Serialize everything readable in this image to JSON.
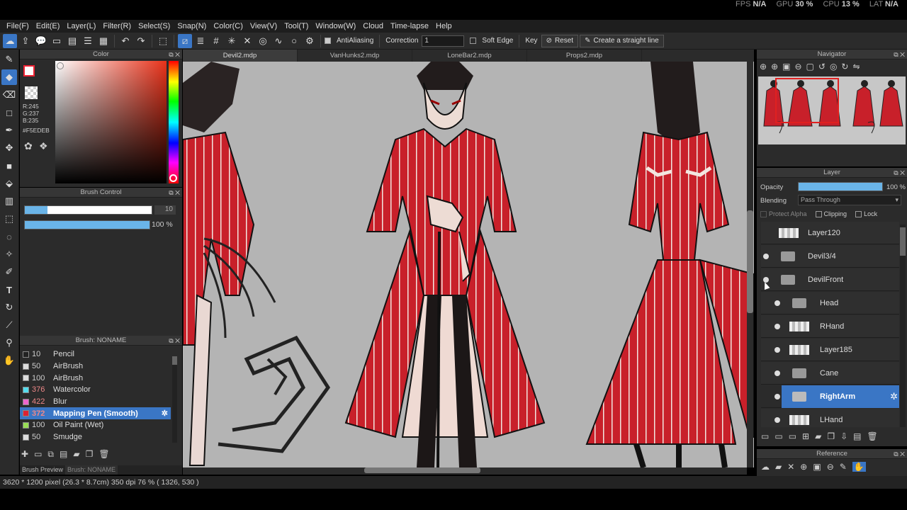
{
  "stats": {
    "fps_label": "FPS",
    "fps": "N/A",
    "gpu_label": "GPU",
    "gpu": "30 %",
    "cpu_label": "CPU",
    "cpu": "13 %",
    "lat_label": "LAT",
    "lat": "N/A"
  },
  "menu": [
    "File(F)",
    "Edit(E)",
    "Layer(L)",
    "Filter(R)",
    "Select(S)",
    "Snap(N)",
    "Color(C)",
    "View(V)",
    "Tool(T)",
    "Window(W)",
    "Cloud",
    "Time-lapse",
    "Help"
  ],
  "toolbar": {
    "antialiasing_label": "AntiAliasing",
    "correction_label": "Correction",
    "correction_value": "1",
    "soft_edge_label": "Soft Edge",
    "key_label": "Key",
    "reset_label": "Reset",
    "straight_line_label": "Create a straight line"
  },
  "color": {
    "panel_title": "Color",
    "r": "R:245",
    "g": "G:237",
    "b": "B:235",
    "hex": "#F5EDEB",
    "accent": "#3a76c5"
  },
  "brush_control": {
    "panel_title": "Brush Control",
    "size_value": "10",
    "opacity_value": "100 %"
  },
  "brush_panel": {
    "panel_title": "Brush: NONAME",
    "footer_tab1": "Brush Preview",
    "footer_tab2": "Brush: NONAME",
    "items": [
      {
        "size": "10",
        "name": "Pencil",
        "swatch": "#222222"
      },
      {
        "size": "50",
        "name": "AirBrush",
        "swatch": "#dddddd"
      },
      {
        "size": "100",
        "name": "AirBrush",
        "swatch": "#dddddd"
      },
      {
        "size": "376",
        "name": "Watercolor",
        "swatch": "#55ddee"
      },
      {
        "size": "422",
        "name": "Blur",
        "swatch": "#ee66cc"
      },
      {
        "size": "372",
        "name": "Mapping Pen (Smooth)",
        "swatch": "#dd2233"
      },
      {
        "size": "100",
        "name": "Oil Paint (Wet)",
        "swatch": "#99dd55"
      },
      {
        "size": "50",
        "name": "Smudge",
        "swatch": "#dddddd"
      }
    ]
  },
  "tabs": [
    "Devil2.mdp",
    "VanHunks2.mdp",
    "LoneBar2.mdp",
    "Props2.mdp"
  ],
  "navigator": {
    "panel_title": "Navigator"
  },
  "layer": {
    "panel_title": "Layer",
    "opacity_label": "Opacity",
    "opacity_value": "100 %",
    "blending_label": "Blending",
    "blending_value": "Pass Through",
    "protect_alpha": "Protect Alpha",
    "clipping": "Clipping",
    "lock": "Lock",
    "rows": [
      {
        "name": "Layer120",
        "type": "px",
        "eye": false,
        "indent": 0
      },
      {
        "name": "Devil3/4",
        "type": "folder",
        "eye": true,
        "indent": 0
      },
      {
        "name": "DevilFront",
        "type": "folder",
        "eye": true,
        "indent": 0
      },
      {
        "name": "Head",
        "type": "folder",
        "eye": true,
        "indent": 1
      },
      {
        "name": "RHand",
        "type": "px",
        "eye": true,
        "indent": 1
      },
      {
        "name": "Layer185",
        "type": "px",
        "eye": true,
        "indent": 1
      },
      {
        "name": "Cane",
        "type": "folder",
        "eye": true,
        "indent": 1
      },
      {
        "name": "RightArm",
        "type": "folder",
        "eye": true,
        "indent": 1,
        "selected": true
      },
      {
        "name": "LHand",
        "type": "px",
        "eye": true,
        "indent": 1
      }
    ]
  },
  "reference": {
    "panel_title": "Reference"
  },
  "status": {
    "text": "3620 * 1200 pixel   (26.3 * 8.7cm)   350 dpi   76 %   ( 1326, 530 )"
  }
}
